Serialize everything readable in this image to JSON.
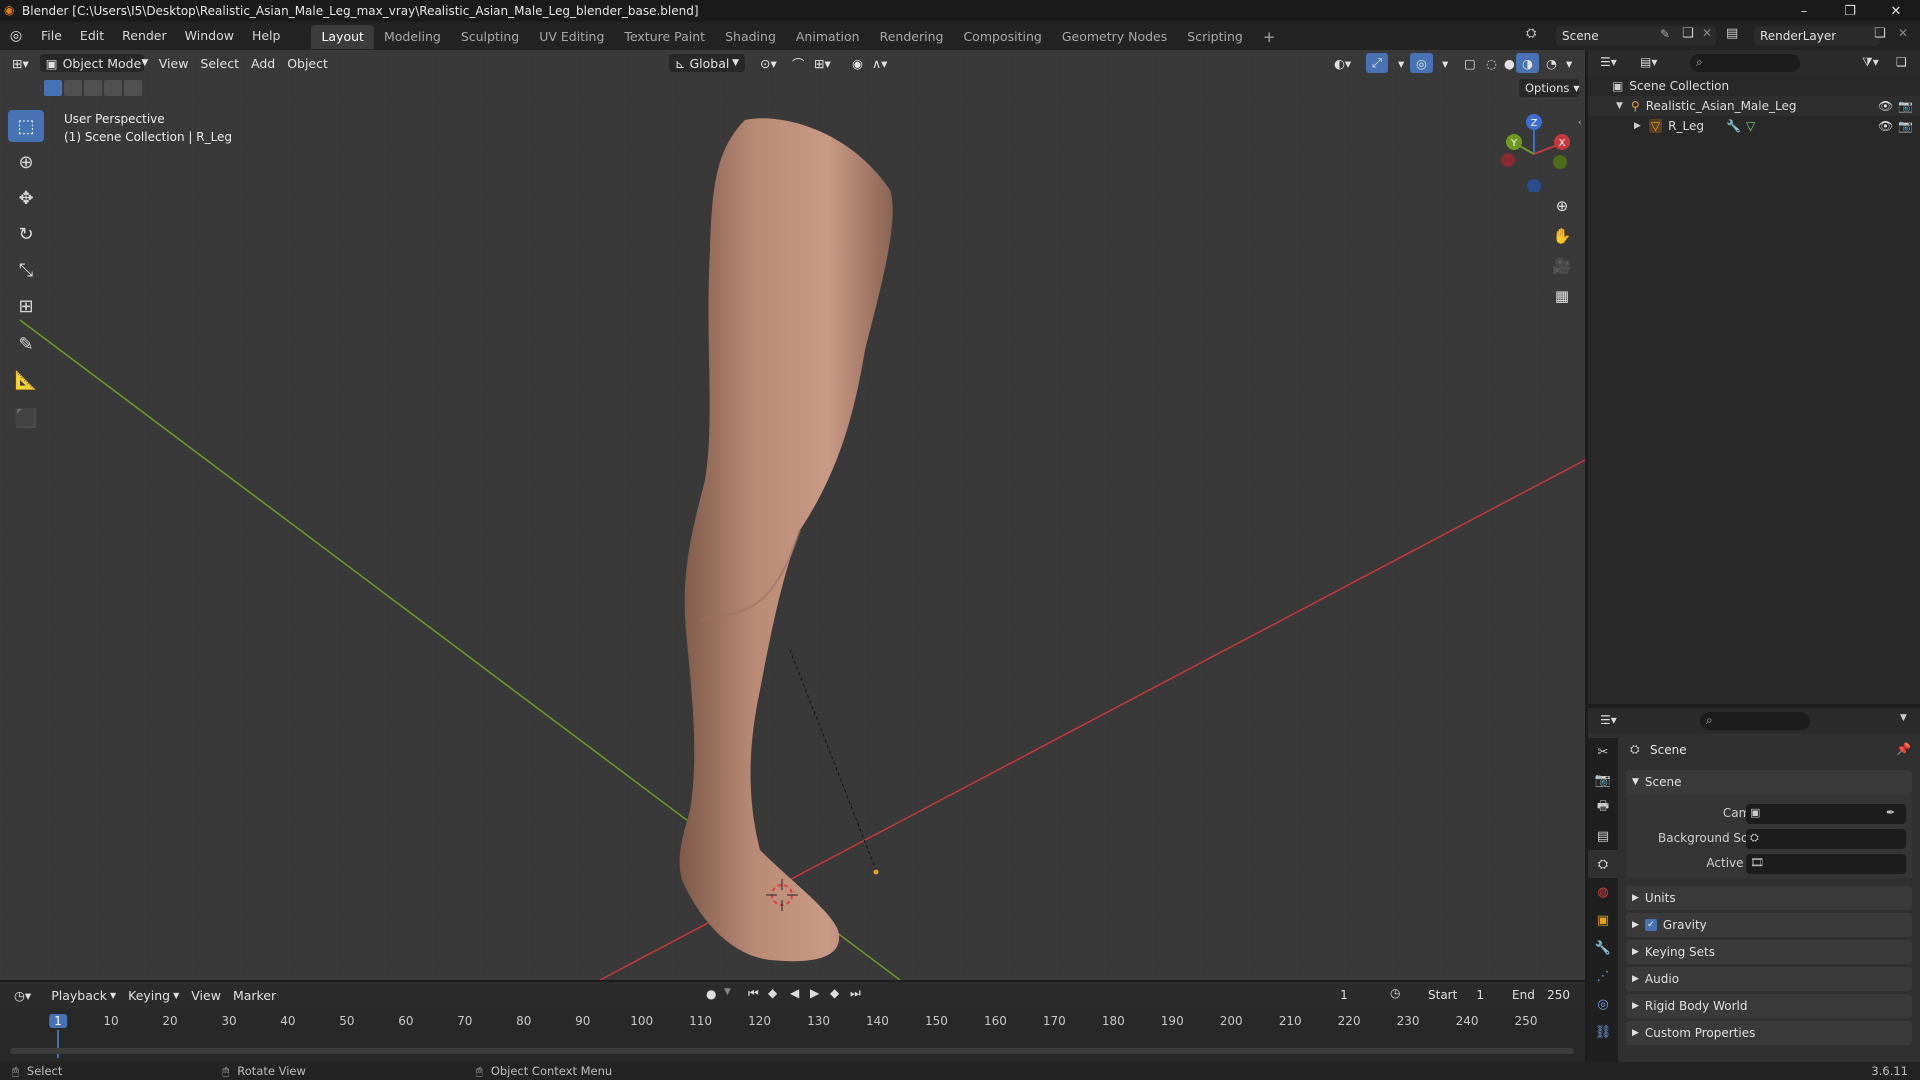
{
  "window": {
    "title": "Blender [C:\\Users\\I5\\Desktop\\Realistic_Asian_Male_Leg_max_vray\\Realistic_Asian_Male_Leg_blender_base.blend]",
    "minimize": "–",
    "maximize": "❐",
    "close": "✕"
  },
  "menu": {
    "file": "File",
    "edit": "Edit",
    "render": "Render",
    "window": "Window",
    "help": "Help"
  },
  "workspaces": [
    "Layout",
    "Modeling",
    "Sculpting",
    "UV Editing",
    "Texture Paint",
    "Shading",
    "Animation",
    "Rendering",
    "Compositing",
    "Geometry Nodes",
    "Scripting"
  ],
  "workspace_add": "+",
  "scene_selector": {
    "value": "Scene"
  },
  "renderlayer_selector": {
    "value": "RenderLayer"
  },
  "viewport": {
    "mode": "Object Mode",
    "menus": {
      "view": "View",
      "select": "Select",
      "add": "Add",
      "object": "Object"
    },
    "orientation": "Global",
    "options_label": "Options",
    "overlay_line1": "User Perspective",
    "overlay_line2": "(1) Scene Collection | R_Leg",
    "gizmo": {
      "x": "X",
      "y": "Y",
      "z": "Z"
    }
  },
  "outliner": {
    "root": "Scene Collection",
    "collection": "Realistic_Asian_Male_Leg",
    "object": "R_Leg"
  },
  "properties": {
    "context_label": "Scene",
    "panel_scene": "Scene",
    "camera_label": "Camera",
    "background_scene_label": "Background Scene",
    "active_clip_label": "Active Clip",
    "panels": [
      "Units",
      "Gravity",
      "Keying Sets",
      "Audio",
      "Rigid Body World",
      "Custom Properties"
    ],
    "gravity_checked": true
  },
  "timeline": {
    "menus": {
      "playback": "Playback",
      "keying": "Keying",
      "view": "View",
      "marker": "Marker"
    },
    "current_frame": "1",
    "start_label": "Start",
    "start_value": "1",
    "end_label": "End",
    "end_value": "250",
    "ticks": [
      "1",
      "10",
      "20",
      "30",
      "40",
      "50",
      "60",
      "70",
      "80",
      "90",
      "100",
      "110",
      "120",
      "130",
      "140",
      "150",
      "160",
      "170",
      "180",
      "190",
      "200",
      "210",
      "220",
      "230",
      "240",
      "250"
    ]
  },
  "statusbar": {
    "select": "Select",
    "rotate_view": "Rotate View",
    "context_menu": "Object Context Menu",
    "version": "3.6.11"
  },
  "colors": {
    "accent": "#4772b3",
    "x_axis": "#c8383f",
    "y_axis": "#6e9a23",
    "z_axis": "#3b6fd6",
    "skin": "#b98a76"
  }
}
